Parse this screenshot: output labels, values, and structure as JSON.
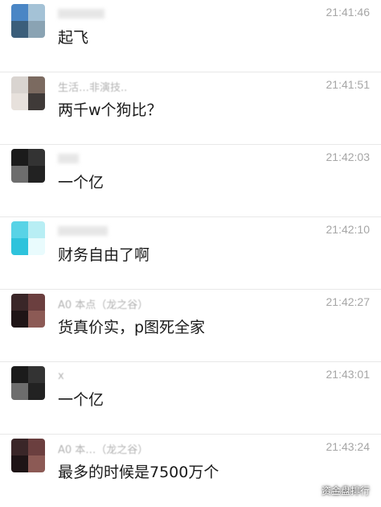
{
  "messages": [
    {
      "sender": "",
      "time": "21:41:46",
      "text": "起飞",
      "avatar_colors": [
        "#4a86c5",
        "#a4c2d6",
        "#3b5e7a",
        "#8aa3b3"
      ]
    },
    {
      "sender": "生活…非演技..",
      "time": "21:41:51",
      "text": "两千w个狗比？",
      "avatar_colors": [
        "#d9d4d0",
        "#7b6a60",
        "#e7e1dc",
        "#3f3a38"
      ]
    },
    {
      "sender": "",
      "time": "21:42:03",
      "text": "一个亿",
      "avatar_colors": [
        "#1b1b1b",
        "#333333",
        "#6d6d6d",
        "#222222"
      ]
    },
    {
      "sender": "",
      "time": "21:42:10",
      "text": "财务自由了啊",
      "avatar_colors": [
        "#58d3e6",
        "#b8eef4",
        "#2ec3dc",
        "#e9fbfd"
      ]
    },
    {
      "sender": "A0 本点（龙之谷）",
      "time": "21:42:27",
      "text": "货真价实，p图死全家",
      "avatar_colors": [
        "#3a2628",
        "#6b3f3f",
        "#1e1416",
        "#8c5a55"
      ]
    },
    {
      "sender": "x",
      "time": "21:43:01",
      "text": "一个亿",
      "avatar_colors": [
        "#1b1b1b",
        "#333333",
        "#6d6d6d",
        "#222222"
      ]
    },
    {
      "sender": "A0 本…（龙之谷）",
      "time": "21:43:24",
      "text": "最多的时候是7500万个",
      "avatar_colors": [
        "#3a2628",
        "#6b3f3f",
        "#1e1416",
        "#8c5a55"
      ]
    }
  ],
  "watermark": {
    "label": "资金盘排行",
    "icon": "wechat-icon"
  }
}
